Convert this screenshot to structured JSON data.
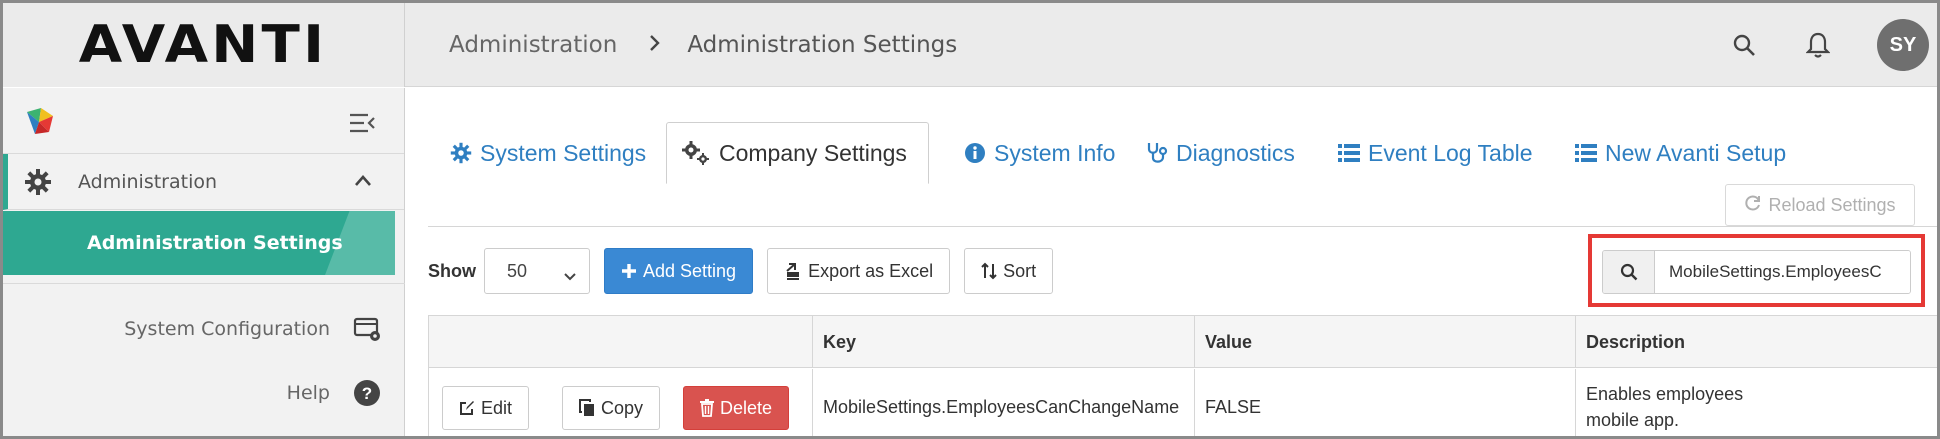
{
  "header": {
    "logo": "AVANTI",
    "breadcrumb": [
      "Administration",
      "Administration Settings"
    ],
    "avatar_initials": "SY"
  },
  "sidebar": {
    "admin_label": "Administration",
    "active_item": "Administration Settings",
    "items": [
      {
        "label": "System Configuration",
        "icon": "system-config-icon"
      },
      {
        "label": "Help",
        "icon": "help-icon"
      }
    ]
  },
  "tabs": [
    {
      "label": "System Settings",
      "icon": "gear-icon",
      "active": false
    },
    {
      "label": "Company Settings",
      "icon": "gears-icon",
      "active": true
    },
    {
      "label": "System Info",
      "icon": "info-icon",
      "active": false
    },
    {
      "label": "Diagnostics",
      "icon": "stethoscope-icon",
      "active": false
    },
    {
      "label": "Event Log Table",
      "icon": "list-icon",
      "active": false
    },
    {
      "label": "New Avanti Setup",
      "icon": "list-icon",
      "active": false
    }
  ],
  "reload_label": "Reload Settings",
  "toolbar": {
    "show_label": "Show",
    "page_size": "50",
    "add_label": "Add Setting",
    "export_label": "Export as Excel",
    "sort_label": "Sort"
  },
  "search": {
    "value": "MobileSettings.EmployeesC"
  },
  "table": {
    "columns": [
      "",
      "Key",
      "Value",
      "Description"
    ],
    "rows": [
      {
        "edit": "Edit",
        "copy": "Copy",
        "delete": "Delete",
        "key": "MobileSettings.EmployeesCanChangeName",
        "value": "FALSE",
        "description_line1": "Enables employees",
        "description_line2": "mobile app."
      }
    ]
  },
  "colors": {
    "accent": "#2ea891",
    "link": "#2f7fc1",
    "primary": "#3a89d4",
    "danger": "#d9534f",
    "highlight": "#e53935"
  }
}
